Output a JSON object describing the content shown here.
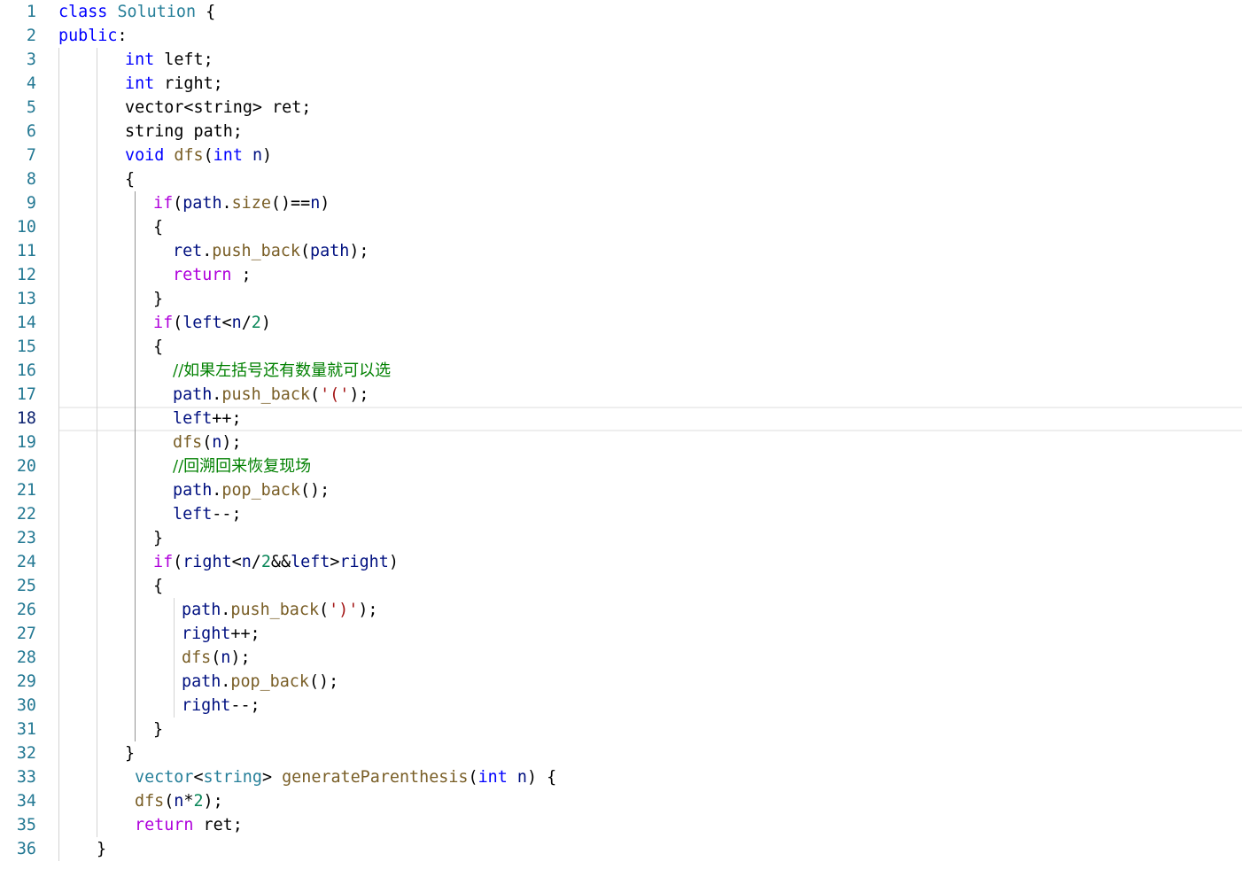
{
  "editor": {
    "active_line": 18,
    "lines": [
      {
        "n": "1",
        "indent": 0,
        "tokens": [
          [
            "kw",
            "class"
          ],
          [
            "plain",
            " "
          ],
          [
            "ty",
            "Solution"
          ],
          [
            "plain",
            " {"
          ]
        ]
      },
      {
        "n": "2",
        "indent": 0,
        "tokens": [
          [
            "kw",
            "public"
          ],
          [
            "plain",
            ":"
          ]
        ]
      },
      {
        "n": "3",
        "indent": 75,
        "tokens": [
          [
            "kw",
            "int"
          ],
          [
            "plain",
            " left;"
          ]
        ]
      },
      {
        "n": "4",
        "indent": 75,
        "tokens": [
          [
            "kw",
            "int"
          ],
          [
            "plain",
            " right;"
          ]
        ]
      },
      {
        "n": "5",
        "indent": 75,
        "tokens": [
          [
            "plain",
            "vector<string> ret;"
          ]
        ]
      },
      {
        "n": "6",
        "indent": 75,
        "tokens": [
          [
            "plain",
            "string path;"
          ]
        ]
      },
      {
        "n": "7",
        "indent": 75,
        "tokens": [
          [
            "kw",
            "void"
          ],
          [
            "plain",
            " "
          ],
          [
            "fn",
            "dfs"
          ],
          [
            "plain",
            "("
          ],
          [
            "kw",
            "int"
          ],
          [
            "plain",
            " "
          ],
          [
            "var",
            "n"
          ],
          [
            "plain",
            ")"
          ]
        ]
      },
      {
        "n": "8",
        "indent": 75,
        "tokens": [
          [
            "plain",
            "{"
          ]
        ]
      },
      {
        "n": "9",
        "indent": 107,
        "tokens": [
          [
            "ctl",
            "if"
          ],
          [
            "plain",
            "("
          ],
          [
            "var",
            "path"
          ],
          [
            "plain",
            "."
          ],
          [
            "fn",
            "size"
          ],
          [
            "plain",
            "()=="
          ],
          [
            "var",
            "n"
          ],
          [
            "plain",
            ")"
          ]
        ]
      },
      {
        "n": "10",
        "indent": 107,
        "tokens": [
          [
            "plain",
            "{"
          ]
        ]
      },
      {
        "n": "11",
        "indent": 129,
        "tokens": [
          [
            "var",
            "ret"
          ],
          [
            "plain",
            "."
          ],
          [
            "fn",
            "push_back"
          ],
          [
            "plain",
            "("
          ],
          [
            "var",
            "path"
          ],
          [
            "plain",
            ");"
          ]
        ]
      },
      {
        "n": "12",
        "indent": 129,
        "tokens": [
          [
            "ctl",
            "return"
          ],
          [
            "plain",
            " ;"
          ]
        ]
      },
      {
        "n": "13",
        "indent": 107,
        "tokens": [
          [
            "plain",
            "}"
          ]
        ]
      },
      {
        "n": "14",
        "indent": 107,
        "tokens": [
          [
            "ctl",
            "if"
          ],
          [
            "plain",
            "("
          ],
          [
            "var",
            "left"
          ],
          [
            "plain",
            "<"
          ],
          [
            "var",
            "n"
          ],
          [
            "plain",
            "/"
          ],
          [
            "num",
            "2"
          ],
          [
            "plain",
            ")"
          ]
        ]
      },
      {
        "n": "15",
        "indent": 107,
        "tokens": [
          [
            "plain",
            "{"
          ]
        ]
      },
      {
        "n": "16",
        "indent": 129,
        "tokens": [
          [
            "com",
            "//如果左括号还有数量就可以选"
          ]
        ]
      },
      {
        "n": "17",
        "indent": 129,
        "tokens": [
          [
            "var",
            "path"
          ],
          [
            "plain",
            "."
          ],
          [
            "fn",
            "push_back"
          ],
          [
            "plain",
            "("
          ],
          [
            "str",
            "'('"
          ],
          [
            "plain",
            ");"
          ]
        ]
      },
      {
        "n": "18",
        "indent": 129,
        "tokens": [
          [
            "var",
            "left"
          ],
          [
            "plain",
            "++;"
          ]
        ]
      },
      {
        "n": "19",
        "indent": 129,
        "tokens": [
          [
            "fn",
            "dfs"
          ],
          [
            "plain",
            "("
          ],
          [
            "var",
            "n"
          ],
          [
            "plain",
            ");"
          ]
        ]
      },
      {
        "n": "20",
        "indent": 129,
        "tokens": [
          [
            "com",
            "//回溯回来恢复现场"
          ]
        ]
      },
      {
        "n": "21",
        "indent": 129,
        "tokens": [
          [
            "var",
            "path"
          ],
          [
            "plain",
            "."
          ],
          [
            "fn",
            "pop_back"
          ],
          [
            "plain",
            "();"
          ]
        ]
      },
      {
        "n": "22",
        "indent": 129,
        "tokens": [
          [
            "var",
            "left"
          ],
          [
            "plain",
            "--;"
          ]
        ]
      },
      {
        "n": "23",
        "indent": 107,
        "tokens": [
          [
            "plain",
            "}"
          ]
        ]
      },
      {
        "n": "24",
        "indent": 107,
        "tokens": [
          [
            "ctl",
            "if"
          ],
          [
            "plain",
            "("
          ],
          [
            "var",
            "right"
          ],
          [
            "plain",
            "<"
          ],
          [
            "var",
            "n"
          ],
          [
            "plain",
            "/"
          ],
          [
            "num",
            "2"
          ],
          [
            "plain",
            "&&"
          ],
          [
            "var",
            "left"
          ],
          [
            "plain",
            ">"
          ],
          [
            "var",
            "right"
          ],
          [
            "plain",
            ")"
          ]
        ]
      },
      {
        "n": "25",
        "indent": 107,
        "tokens": [
          [
            "plain",
            "{"
          ]
        ]
      },
      {
        "n": "26",
        "indent": 139,
        "tokens": [
          [
            "var",
            "path"
          ],
          [
            "plain",
            "."
          ],
          [
            "fn",
            "push_back"
          ],
          [
            "plain",
            "("
          ],
          [
            "str",
            "')'"
          ],
          [
            "plain",
            ");"
          ]
        ]
      },
      {
        "n": "27",
        "indent": 139,
        "tokens": [
          [
            "var",
            "right"
          ],
          [
            "plain",
            "++;"
          ]
        ]
      },
      {
        "n": "28",
        "indent": 139,
        "tokens": [
          [
            "fn",
            "dfs"
          ],
          [
            "plain",
            "("
          ],
          [
            "var",
            "n"
          ],
          [
            "plain",
            ");"
          ]
        ]
      },
      {
        "n": "29",
        "indent": 139,
        "tokens": [
          [
            "var",
            "path"
          ],
          [
            "plain",
            "."
          ],
          [
            "fn",
            "pop_back"
          ],
          [
            "plain",
            "();"
          ]
        ]
      },
      {
        "n": "30",
        "indent": 139,
        "tokens": [
          [
            "var",
            "right"
          ],
          [
            "plain",
            "--;"
          ]
        ]
      },
      {
        "n": "31",
        "indent": 107,
        "tokens": [
          [
            "plain",
            "}"
          ]
        ]
      },
      {
        "n": "32",
        "indent": 75,
        "tokens": [
          [
            "plain",
            "}"
          ]
        ]
      },
      {
        "n": "33",
        "indent": 86,
        "tokens": [
          [
            "ty",
            "vector"
          ],
          [
            "plain",
            "<"
          ],
          [
            "ty",
            "string"
          ],
          [
            "plain",
            "> "
          ],
          [
            "fn",
            "generateParenthesis"
          ],
          [
            "plain",
            "("
          ],
          [
            "kw",
            "int"
          ],
          [
            "plain",
            " "
          ],
          [
            "var",
            "n"
          ],
          [
            "plain",
            ") {"
          ]
        ]
      },
      {
        "n": "34",
        "indent": 86,
        "tokens": [
          [
            "fn",
            "dfs"
          ],
          [
            "plain",
            "("
          ],
          [
            "var",
            "n"
          ],
          [
            "plain",
            "*"
          ],
          [
            "num",
            "2"
          ],
          [
            "plain",
            ");"
          ]
        ]
      },
      {
        "n": "35",
        "indent": 86,
        "tokens": [
          [
            "ctl",
            "return"
          ],
          [
            "plain",
            " ret;"
          ]
        ]
      },
      {
        "n": "36",
        "indent": 43,
        "tokens": [
          [
            "plain",
            "}"
          ]
        ]
      }
    ]
  }
}
